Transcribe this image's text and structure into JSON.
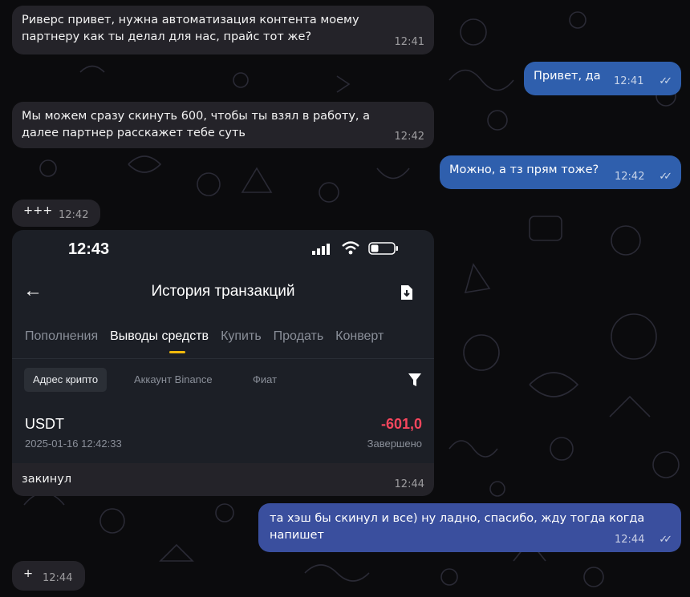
{
  "messages": [
    {
      "text": "Риверс привет, нужна автоматизация контента моему партнеру как ты делал для нас, прайс тот же?",
      "time": "12:41"
    },
    {
      "text": "Привет, да",
      "time": "12:41"
    },
    {
      "text": "Мы можем сразу скинуть 600, чтобы ты взял в работу, а далее партнер расскажет тебе суть",
      "time": "12:42"
    },
    {
      "text": "Можно, а тз прям тоже?",
      "time": "12:42"
    },
    {
      "text": "+++",
      "time": "12:42"
    },
    {
      "text": "закинул",
      "time": "12:44"
    },
    {
      "text": "та хэш бы скинул и все) ну ладно, спасибо, жду тогда когда напишет",
      "time": "12:44"
    },
    {
      "text": "+",
      "time": "12:44"
    }
  ],
  "screenshot": {
    "clock": "12:43",
    "title": "История транзакций",
    "back_icon": "arrow-left-icon",
    "export_icon": "download-file-icon",
    "tabs": [
      "Пополнения",
      "Выводы средств",
      "Купить",
      "Продать",
      "Конверт"
    ],
    "active_tab": "Выводы средств",
    "filters": [
      "Адрес крипто",
      "Аккаунт Binance",
      "Фиат"
    ],
    "transaction": {
      "coin": "USDT",
      "datetime": "2025-01-16 12:42:33",
      "amount": "-601,0",
      "status": "Завершено"
    }
  },
  "colors": {
    "incoming": "#242329",
    "outgoing": "#2f5fad",
    "negative": "#f6465d",
    "accent": "#f0b90b"
  }
}
